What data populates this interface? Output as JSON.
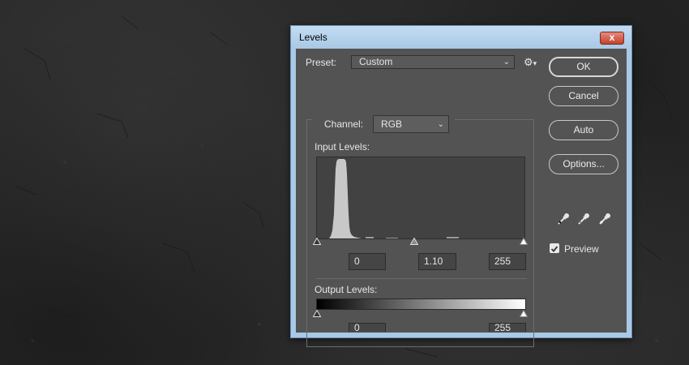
{
  "window": {
    "title": "Levels",
    "close_glyph": "x"
  },
  "preset": {
    "label": "Preset:",
    "value": "Custom",
    "menu_icon": "gear-icon"
  },
  "buttons": {
    "ok": "OK",
    "cancel": "Cancel",
    "auto": "Auto",
    "options": "Options..."
  },
  "eyedroppers": [
    "black-point-eyedropper-icon",
    "gray-point-eyedropper-icon",
    "white-point-eyedropper-icon"
  ],
  "preview": {
    "label": "Preview",
    "checked": true
  },
  "channel": {
    "label": "Channel:",
    "value": "RGB"
  },
  "input_levels": {
    "label": "Input Levels:",
    "black": "0",
    "midtone": "1.10",
    "white": "255"
  },
  "output_levels": {
    "label": "Output Levels:",
    "black": "0",
    "white": "255"
  },
  "colors": {
    "panel": "#535353",
    "titlebar": "#b5d2ee",
    "close": "#c9462f"
  }
}
